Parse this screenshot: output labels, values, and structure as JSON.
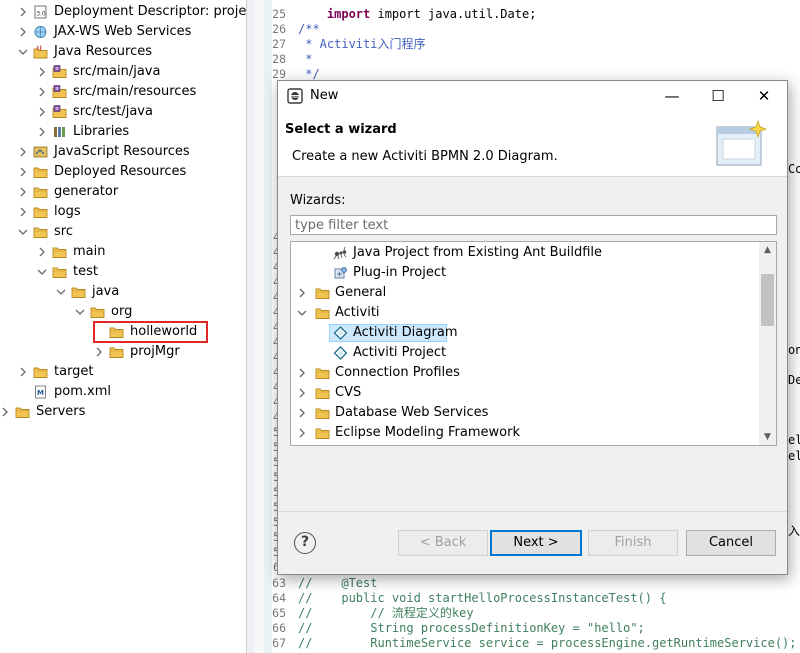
{
  "explorer": {
    "items": [
      {
        "label": "Deployment Descriptor: projectM",
        "icon": "deployment-descriptor-icon",
        "twisty": "right",
        "depth": 1
      },
      {
        "label": "JAX-WS Web Services",
        "icon": "web-services-icon",
        "twisty": "right",
        "depth": 1
      },
      {
        "label": "Java Resources",
        "icon": "java-resources-icon",
        "twisty": "down",
        "depth": 1
      },
      {
        "label": "src/main/java",
        "icon": "source-folder-icon",
        "twisty": "right",
        "depth": 2
      },
      {
        "label": "src/main/resources",
        "icon": "source-folder-icon",
        "twisty": "right",
        "depth": 2
      },
      {
        "label": "src/test/java",
        "icon": "source-folder-icon",
        "twisty": "right",
        "depth": 2
      },
      {
        "label": "Libraries",
        "icon": "libraries-icon",
        "twisty": "right",
        "depth": 2
      },
      {
        "label": "JavaScript Resources",
        "icon": "javascript-resources-icon",
        "twisty": "right",
        "depth": 1
      },
      {
        "label": "Deployed Resources",
        "icon": "deployed-resources-icon",
        "twisty": "right",
        "depth": 1
      },
      {
        "label": "generator",
        "icon": "folder-icon",
        "twisty": "right",
        "depth": 1
      },
      {
        "label": "logs",
        "icon": "folder-icon",
        "twisty": "right",
        "depth": 1
      },
      {
        "label": "src",
        "icon": "folder-icon",
        "twisty": "down",
        "depth": 1
      },
      {
        "label": "main",
        "icon": "folder-icon",
        "twisty": "right",
        "depth": 2
      },
      {
        "label": "test",
        "icon": "folder-icon",
        "twisty": "down",
        "depth": 2
      },
      {
        "label": "java",
        "icon": "folder-icon",
        "twisty": "down",
        "depth": 3
      },
      {
        "label": "org",
        "icon": "folder-icon",
        "twisty": "down",
        "depth": 4
      },
      {
        "label": "holleworld",
        "icon": "folder-icon",
        "twisty": "none",
        "depth": 5,
        "highlighted": true
      },
      {
        "label": "projMgr",
        "icon": "folder-icon",
        "twisty": "right",
        "depth": 5
      },
      {
        "label": "target",
        "icon": "folder-icon",
        "twisty": "right",
        "depth": 1
      },
      {
        "label": "pom.xml",
        "icon": "xml-file-icon",
        "twisty": "none",
        "depth": 1
      },
      {
        "label": "Servers",
        "icon": "folder-icon",
        "twisty": "right",
        "depth": 0
      }
    ]
  },
  "editor": {
    "top_fragment": "import java.util.Date;",
    "lines": [
      {
        "n": "25",
        "t": "",
        "cls": "c-bg"
      },
      {
        "n": "26",
        "t": "/**",
        "cls": "c-doc"
      },
      {
        "n": "27",
        "t": " * Activiti入门程序",
        "cls": "c-doc"
      },
      {
        "n": "28",
        "t": " *",
        "cls": "c-doc"
      },
      {
        "n": "29",
        "t": " */",
        "cls": "c-doc"
      }
    ],
    "bottom_lines": [
      {
        "n": "63",
        "t": "//    @Test",
        "cls": "c-com"
      },
      {
        "n": "64",
        "t": "//    public void startHelloProcessInstanceTest() {",
        "cls": "c-com"
      },
      {
        "n": "65",
        "t": "//        // 流程定义的key",
        "cls": "c-com"
      },
      {
        "n": "66",
        "t": "//        String processDefinitionKey = \"hello\";",
        "cls": "c-com"
      },
      {
        "n": "67",
        "t": "//        RuntimeService service = processEngine.getRuntimeService();",
        "cls": "c-com"
      }
    ],
    "partial_gutter_digits": [
      "4",
      "4",
      "4",
      "4",
      "4",
      "4",
      "4",
      "4",
      "4",
      "4",
      "4",
      "4",
      "4",
      "5",
      "5",
      "5",
      "5",
      "5",
      "5",
      "5",
      "5",
      "5",
      "6"
    ],
    "right_edge_fragments": [
      {
        "text": "Co",
        "row": 162
      },
      {
        "text": "on",
        "row": 343
      },
      {
        "text": "De",
        "row": 373
      },
      {
        "text": "el",
        "row": 433
      },
      {
        "text": "el",
        "row": 449
      },
      {
        "text": "入",
        "row": 522
      }
    ]
  },
  "dialog": {
    "title": "New",
    "minimize_glyph": "—",
    "maximize_glyph": "☐",
    "close_glyph": "✕",
    "banner_title": "Select a wizard",
    "banner_desc": "Create a new Activiti BPMN 2.0 Diagram.",
    "wizards_label": "Wizards:",
    "filter_placeholder": "type filter text",
    "filter_value": "",
    "list": [
      {
        "label": "Java Project from Existing Ant Buildfile",
        "icon": "ant-icon",
        "twisty": "none",
        "depth": 1
      },
      {
        "label": "Plug-in Project",
        "icon": "plugin-project-icon",
        "twisty": "none",
        "depth": 1
      },
      {
        "label": "General",
        "icon": "folder-icon",
        "twisty": "right",
        "depth": 0
      },
      {
        "label": "Activiti",
        "icon": "folder-icon",
        "twisty": "down",
        "depth": 0
      },
      {
        "label": "Activiti Diagram",
        "icon": "activiti-diagram-icon",
        "twisty": "none",
        "depth": 1,
        "selected": true
      },
      {
        "label": "Activiti Project",
        "icon": "activiti-project-icon",
        "twisty": "none",
        "depth": 1
      },
      {
        "label": "Connection Profiles",
        "icon": "folder-icon",
        "twisty": "right",
        "depth": 0
      },
      {
        "label": "CVS",
        "icon": "folder-icon",
        "twisty": "right",
        "depth": 0
      },
      {
        "label": "Database Web Services",
        "icon": "folder-icon",
        "twisty": "right",
        "depth": 0
      },
      {
        "label": "Eclipse Modeling Framework",
        "icon": "folder-icon",
        "twisty": "right",
        "depth": 0
      }
    ],
    "buttons": {
      "help": "?",
      "back": "< Back",
      "next": "Next >",
      "finish": "Finish",
      "cancel": "Cancel"
    }
  },
  "colors": {
    "highlight_box": "#e02828",
    "selection_bg": "#cce8ff",
    "folder": "#e8b64c"
  }
}
